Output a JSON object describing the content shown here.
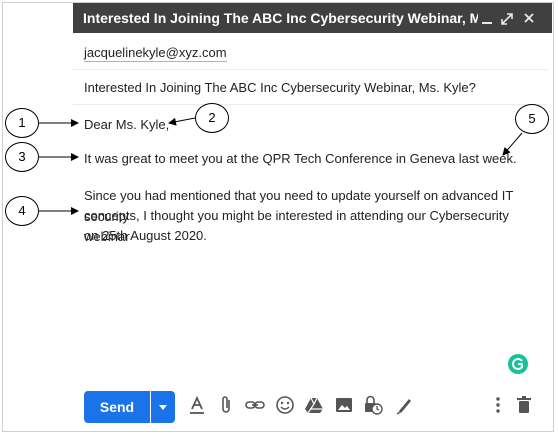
{
  "window": {
    "title": "Interested In Joining The ABC Inc Cybersecurity Webinar, Ms...."
  },
  "compose": {
    "to": "jacquelinekyle@xyz.com",
    "subject": "Interested In Joining The ABC Inc Cybersecurity Webinar, Ms. Kyle?",
    "body": {
      "greeting": "Dear Ms. Kyle,",
      "line1": "It was great to meet you at the QPR Tech Conference in Geneva last week.",
      "para2_line1": "Since you had mentioned that you need to update yourself on advanced IT security",
      "para2_line2": "concepts, I thought you might be interested in attending our Cybersecurity webinar",
      "para2_line3": "on 25th August 2020."
    }
  },
  "annotations": {
    "c1": "1",
    "c2": "2",
    "c3": "3",
    "c4": "4",
    "c5": "5"
  },
  "toolbar": {
    "send_label": "Send",
    "icons": [
      "formatting-icon",
      "attach-icon",
      "link-icon",
      "emoji-icon",
      "drive-icon",
      "photo-icon",
      "confidential-icon",
      "signature-icon",
      "more-options-icon",
      "trash-icon"
    ]
  },
  "colors": {
    "titlebar": "#404040",
    "send": "#1a73e8",
    "grammarly": "#15c39a"
  }
}
